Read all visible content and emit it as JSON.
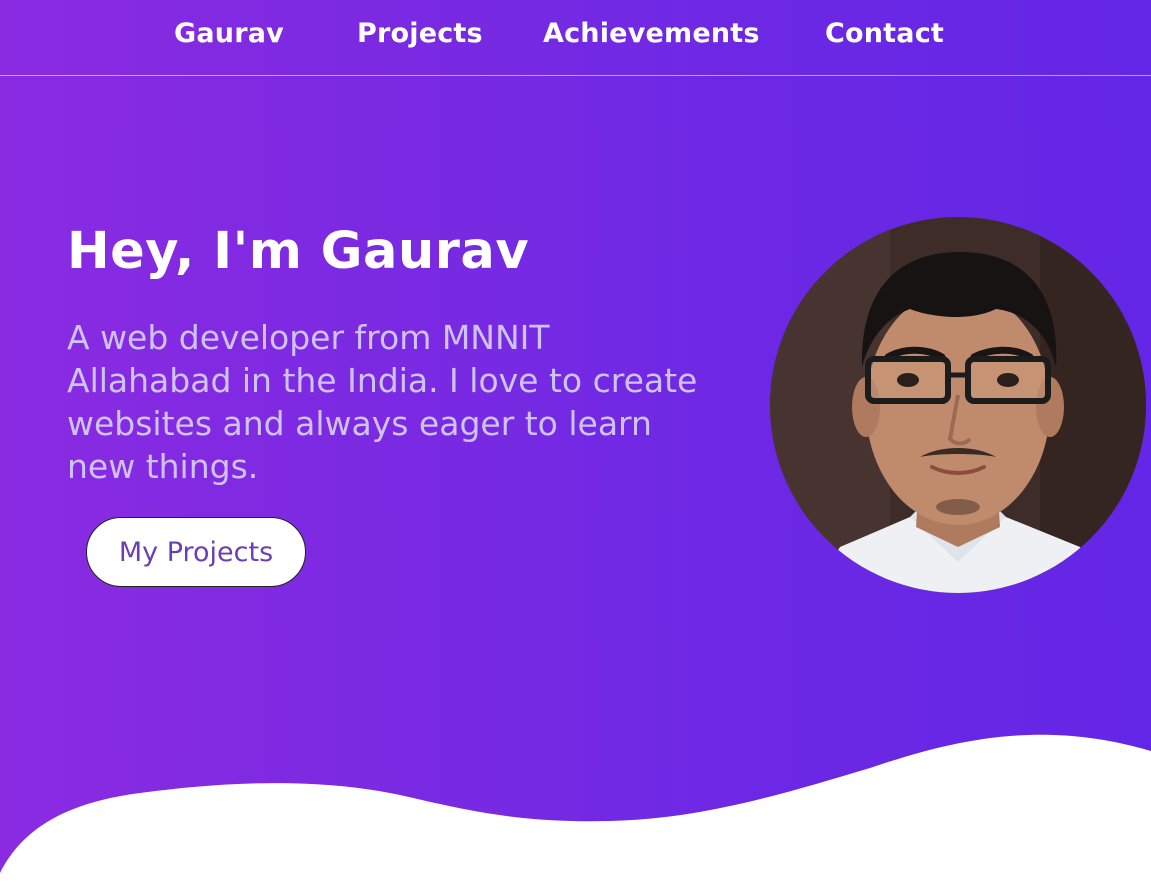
{
  "nav": {
    "items": [
      {
        "label": "Gaurav"
      },
      {
        "label": "Projects"
      },
      {
        "label": "Achievements"
      },
      {
        "label": "Contact"
      }
    ]
  },
  "hero": {
    "title": "Hey, I'm Gaurav",
    "description": "A web developer from MNNIT Allahabad in the India. I love to create websites and always eager to learn new things.",
    "cta_label": "My Projects"
  },
  "colors": {
    "gradient_start": "#8a2be2",
    "gradient_end": "#6426e6",
    "text_primary": "#ffffff",
    "text_secondary": "#cfc3f5",
    "button_text": "#6b3fb0"
  },
  "images": {
    "profile_photo": "profile-photo"
  }
}
